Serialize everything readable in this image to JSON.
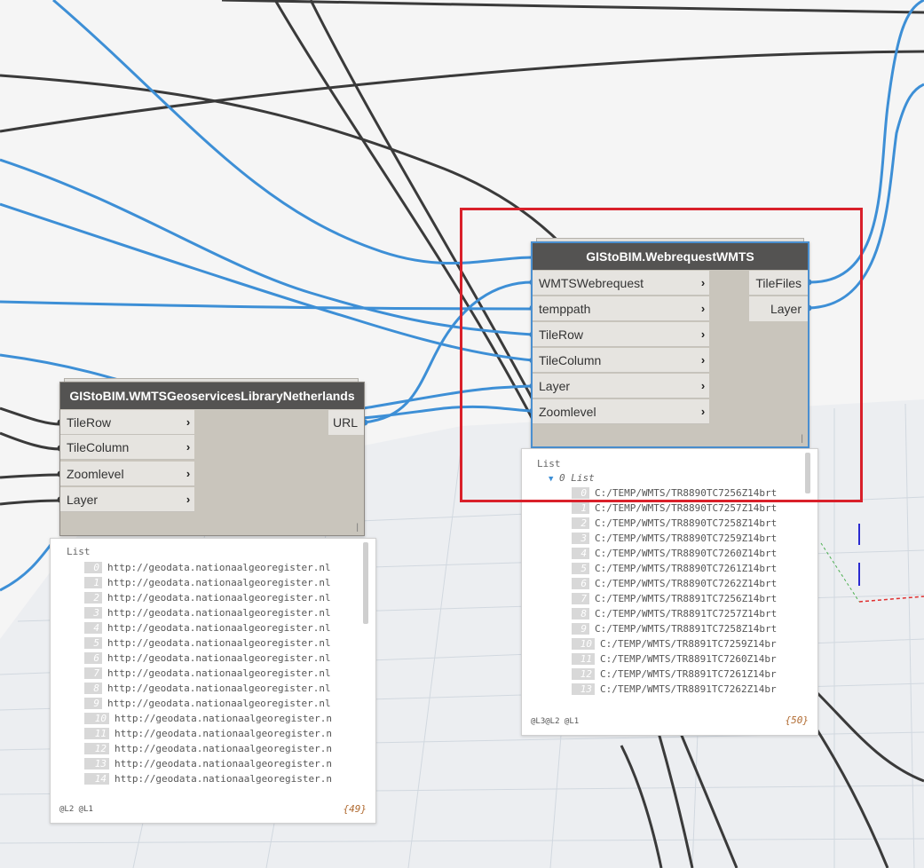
{
  "colors": {
    "wire_blue": "#3d8fd6",
    "wire_dark": "#3a3a3a",
    "highlight_red": "#d9202a",
    "node_title_bg": "#545352"
  },
  "library_node": {
    "title": "GIStoBIM.WMTSGeoservicesLibraryNetherlands",
    "inputs": [
      "TileRow",
      "TileColumn",
      "Zoomlevel",
      "Layer"
    ],
    "outputs": [
      "URL"
    ],
    "grip": "|"
  },
  "webrequest_node": {
    "title": "GIStoBIM.WebrequestWMTS",
    "inputs": [
      "WMTSWebrequest",
      "temppath",
      "TileRow",
      "TileColumn",
      "Layer",
      "Zoomlevel"
    ],
    "outputs": [
      "TileFiles",
      "Layer"
    ],
    "grip": "|"
  },
  "library_preview": {
    "header": "List",
    "rows": [
      {
        "index": "0",
        "value": "http://geodata.nationaalgeoregister.nl"
      },
      {
        "index": "1",
        "value": "http://geodata.nationaalgeoregister.nl"
      },
      {
        "index": "2",
        "value": "http://geodata.nationaalgeoregister.nl"
      },
      {
        "index": "3",
        "value": "http://geodata.nationaalgeoregister.nl"
      },
      {
        "index": "4",
        "value": "http://geodata.nationaalgeoregister.nl"
      },
      {
        "index": "5",
        "value": "http://geodata.nationaalgeoregister.nl"
      },
      {
        "index": "6",
        "value": "http://geodata.nationaalgeoregister.nl"
      },
      {
        "index": "7",
        "value": "http://geodata.nationaalgeoregister.nl"
      },
      {
        "index": "8",
        "value": "http://geodata.nationaalgeoregister.nl"
      },
      {
        "index": "9",
        "value": "http://geodata.nationaalgeoregister.nl"
      },
      {
        "index": "10",
        "value": "http://geodata.nationaalgeoregister.n"
      },
      {
        "index": "11",
        "value": "http://geodata.nationaalgeoregister.n"
      },
      {
        "index": "12",
        "value": "http://geodata.nationaalgeoregister.n"
      },
      {
        "index": "13",
        "value": "http://geodata.nationaalgeoregister.n"
      },
      {
        "index": "14",
        "value": "http://geodata.nationaalgeoregister.n"
      }
    ],
    "levels": "@L2 @L1",
    "count": "{49}"
  },
  "webrequest_preview": {
    "header": "List",
    "sublist": "0 List",
    "rows": [
      {
        "index": "0",
        "value": "C:/TEMP/WMTS/TR8890TC7256Z14brt"
      },
      {
        "index": "1",
        "value": "C:/TEMP/WMTS/TR8890TC7257Z14brt"
      },
      {
        "index": "2",
        "value": "C:/TEMP/WMTS/TR8890TC7258Z14brt"
      },
      {
        "index": "3",
        "value": "C:/TEMP/WMTS/TR8890TC7259Z14brt"
      },
      {
        "index": "4",
        "value": "C:/TEMP/WMTS/TR8890TC7260Z14brt"
      },
      {
        "index": "5",
        "value": "C:/TEMP/WMTS/TR8890TC7261Z14brt"
      },
      {
        "index": "6",
        "value": "C:/TEMP/WMTS/TR8890TC7262Z14brt"
      },
      {
        "index": "7",
        "value": "C:/TEMP/WMTS/TR8891TC7256Z14brt"
      },
      {
        "index": "8",
        "value": "C:/TEMP/WMTS/TR8891TC7257Z14brt"
      },
      {
        "index": "9",
        "value": "C:/TEMP/WMTS/TR8891TC7258Z14brt"
      },
      {
        "index": "10",
        "value": "C:/TEMP/WMTS/TR8891TC7259Z14br"
      },
      {
        "index": "11",
        "value": "C:/TEMP/WMTS/TR8891TC7260Z14br"
      },
      {
        "index": "12",
        "value": "C:/TEMP/WMTS/TR8891TC7261Z14br"
      },
      {
        "index": "13",
        "value": "C:/TEMP/WMTS/TR8891TC7262Z14br"
      }
    ],
    "levels": "@L3@L2 @L1",
    "count": "{50}"
  }
}
